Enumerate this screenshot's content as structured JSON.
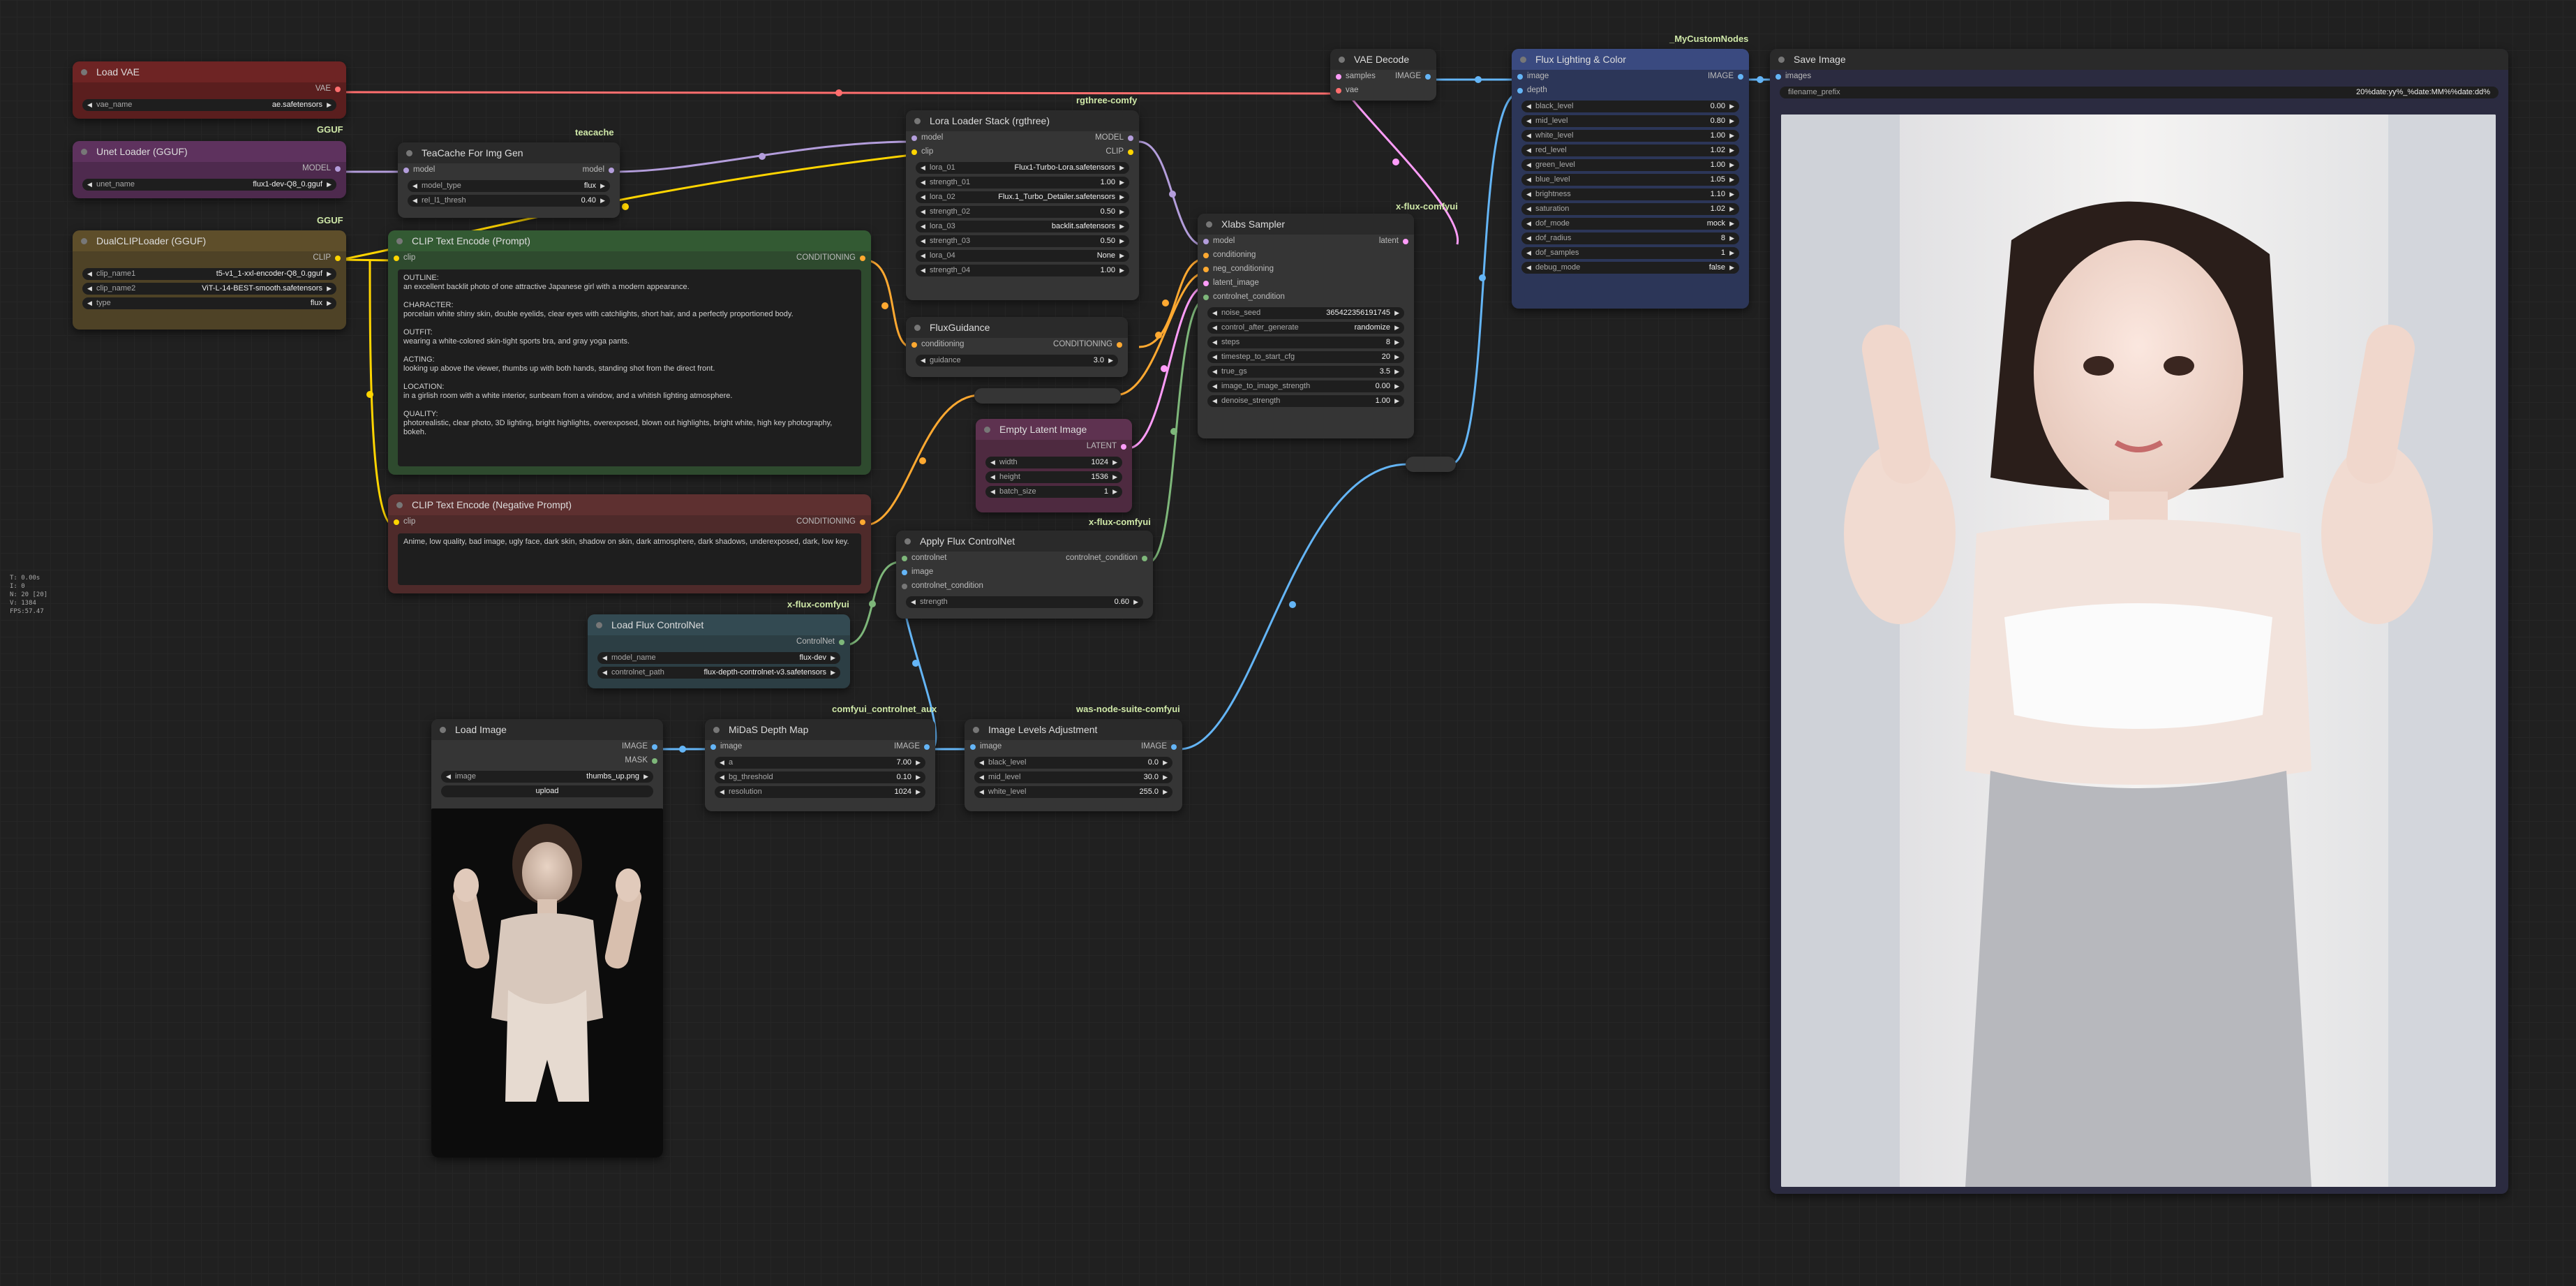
{
  "stats": [
    "T: 0.00s",
    "I: 0",
    "N: 20 [20]",
    "V: 1384",
    "FPS:57.47"
  ],
  "nodes": {
    "load_vae": {
      "title": "Load VAE",
      "out": "VAE",
      "vae_name_label": "vae_name",
      "vae_name": "ae.safetensors"
    },
    "unet": {
      "title": "Unet Loader (GGUF)",
      "tag": "GGUF",
      "out": "MODEL",
      "unet_label": "unet_name",
      "unet_name": "flux1-dev-Q8_0.gguf"
    },
    "dualclip": {
      "title": "DualCLIPLoader (GGUF)",
      "tag": "GGUF",
      "out": "CLIP",
      "c1l": "clip_name1",
      "c1": "t5-v1_1-xxl-encoder-Q8_0.gguf",
      "c2l": "clip_name2",
      "c2": "ViT-L-14-BEST-smooth.safetensors",
      "tl": "type",
      "t": "flux"
    },
    "teacache": {
      "title": "TeaCache For Img Gen",
      "tag": "teacache",
      "in": "model",
      "out": "model",
      "mt_l": "model_type",
      "mt": "flux",
      "rel_l": "rel_l1_thresh",
      "rel": "0.40"
    },
    "clip_pos": {
      "title": "CLIP Text Encode (Prompt)",
      "in": "clip",
      "out": "CONDITIONING",
      "text": "OUTLINE:\nan excellent backlit photo of one attractive Japanese girl with a modern appearance.\n\nCHARACTER:\nporcelain white shiny skin, double eyelids, clear eyes with catchlights, short hair, and a perfectly proportioned body.\n\nOUTFIT:\nwearing a white-colored skin-tight sports bra, and gray yoga pants.\n\nACTING:\nlooking up above the viewer, thumbs up with both hands, standing shot from the direct front.\n\nLOCATION:\nin a girlish room with a white interior, sunbeam from a window, and a whitish lighting atmosphere.\n\nQUALITY:\nphotorealistic, clear photo, 3D lighting, bright highlights, overexposed, blown out highlights, bright white, high key photography, bokeh."
    },
    "clip_neg": {
      "title": "CLIP Text Encode (Negative Prompt)",
      "in": "clip",
      "out": "CONDITIONING",
      "text": "Anime, low quality, bad image, ugly face, dark skin, shadow on skin, dark atmosphere, dark shadows, underexposed, dark, low key."
    },
    "lora": {
      "title": "Lora Loader Stack (rgthree)",
      "tag": "rgthree-comfy",
      "in1": "model",
      "in2": "clip",
      "out1": "MODEL",
      "out2": "CLIP",
      "rows": [
        {
          "l": "lora_01",
          "v": "Flux1-Turbo-Lora.safetensors"
        },
        {
          "l": "strength_01",
          "v": "1.00"
        },
        {
          "l": "lora_02",
          "v": "Flux.1_Turbo_Detailer.safetensors"
        },
        {
          "l": "strength_02",
          "v": "0.50"
        },
        {
          "l": "lora_03",
          "v": "backlit.safetensors"
        },
        {
          "l": "strength_03",
          "v": "0.50"
        },
        {
          "l": "lora_04",
          "v": "None"
        },
        {
          "l": "strength_04",
          "v": "1.00"
        }
      ]
    },
    "flux_guidance": {
      "title": "FluxGuidance",
      "in": "conditioning",
      "out": "CONDITIONING",
      "gl": "guidance",
      "g": "3.0"
    },
    "empty_latent": {
      "title": "Empty Latent Image",
      "out": "LATENT",
      "wl": "width",
      "w": "1024",
      "hl": "height",
      "h": "1536",
      "bl": "batch_size",
      "b": "1"
    },
    "vae_decode": {
      "title": "VAE Decode",
      "in1": "samples",
      "in2": "vae",
      "out": "IMAGE"
    },
    "xlabs": {
      "title": "Xlabs Sampler",
      "tag": "x-flux-comfyui",
      "ins": [
        "model",
        "conditioning",
        "neg_conditioning",
        "latent_image",
        "controlnet_condition"
      ],
      "out": "latent",
      "rows": [
        {
          "l": "noise_seed",
          "v": "365422356191745"
        },
        {
          "l": "control_after_generate",
          "v": "randomize"
        },
        {
          "l": "steps",
          "v": "8"
        },
        {
          "l": "timestep_to_start_cfg",
          "v": "20"
        },
        {
          "l": "true_gs",
          "v": "3.5"
        },
        {
          "l": "image_to_image_strength",
          "v": "0.00"
        },
        {
          "l": "denoise_strength",
          "v": "1.00"
        }
      ]
    },
    "apply_cn": {
      "title": "Apply Flux ControlNet",
      "tag": "x-flux-comfyui",
      "ins": [
        "controlnet",
        "image",
        "controlnet_condition"
      ],
      "out": "controlnet_condition",
      "sl": "strength",
      "s": "0.60"
    },
    "load_cn": {
      "title": "Load Flux ControlNet",
      "tag": "x-flux-comfyui",
      "out": "ControlNet",
      "ml": "model_name",
      "m": "flux-dev",
      "pl": "controlnet_path",
      "p": "flux-depth-controlnet-v3.safetensors"
    },
    "load_image": {
      "title": "Load Image",
      "out1": "IMAGE",
      "out2": "MASK",
      "il": "image",
      "i": "thumbs_up.png",
      "upload": "upload"
    },
    "midas": {
      "title": "MiDaS Depth Map",
      "tag": "comfyui_controlnet_aux",
      "in": "image",
      "out": "IMAGE",
      "al": "a",
      "a": "7.00",
      "bgl": "bg_threshold",
      "bg": "0.10",
      "rl": "resolution",
      "r": "1024"
    },
    "levels": {
      "title": "Image Levels Adjustment",
      "tag": "was-node-suite-comfyui",
      "in": "image",
      "out": "IMAGE",
      "bl": "black_level",
      "b": "0.0",
      "ml": "mid_level",
      "m": "30.0",
      "wl": "white_level",
      "w": "255.0"
    },
    "flux_light": {
      "title": "Flux Lighting & Color",
      "tag": "_MyCustomNodes",
      "in1": "image",
      "in2": "depth",
      "out": "IMAGE",
      "rows": [
        {
          "l": "black_level",
          "v": "0.00"
        },
        {
          "l": "mid_level",
          "v": "0.80"
        },
        {
          "l": "white_level",
          "v": "1.00"
        },
        {
          "l": "red_level",
          "v": "1.02"
        },
        {
          "l": "green_level",
          "v": "1.00"
        },
        {
          "l": "blue_level",
          "v": "1.05"
        },
        {
          "l": "brightness",
          "v": "1.10"
        },
        {
          "l": "saturation",
          "v": "1.02"
        },
        {
          "l": "dof_mode",
          "v": "mock"
        },
        {
          "l": "dof_radius",
          "v": "8"
        },
        {
          "l": "dof_samples",
          "v": "1"
        },
        {
          "l": "debug_mode",
          "v": "false"
        }
      ]
    },
    "save_image": {
      "title": "Save Image",
      "in": "images",
      "fl": "filename_prefix",
      "f": "20%date:yy%_%date:MM%%date:dd%"
    }
  },
  "colors": {
    "vae": "#ff6e6e",
    "model": "#b39ddb",
    "clip": "#ffd500",
    "conditioning": "#ffa931",
    "latent": "#ff9cf9",
    "image": "#64b5f6",
    "controlnet": "#7eb77a"
  }
}
